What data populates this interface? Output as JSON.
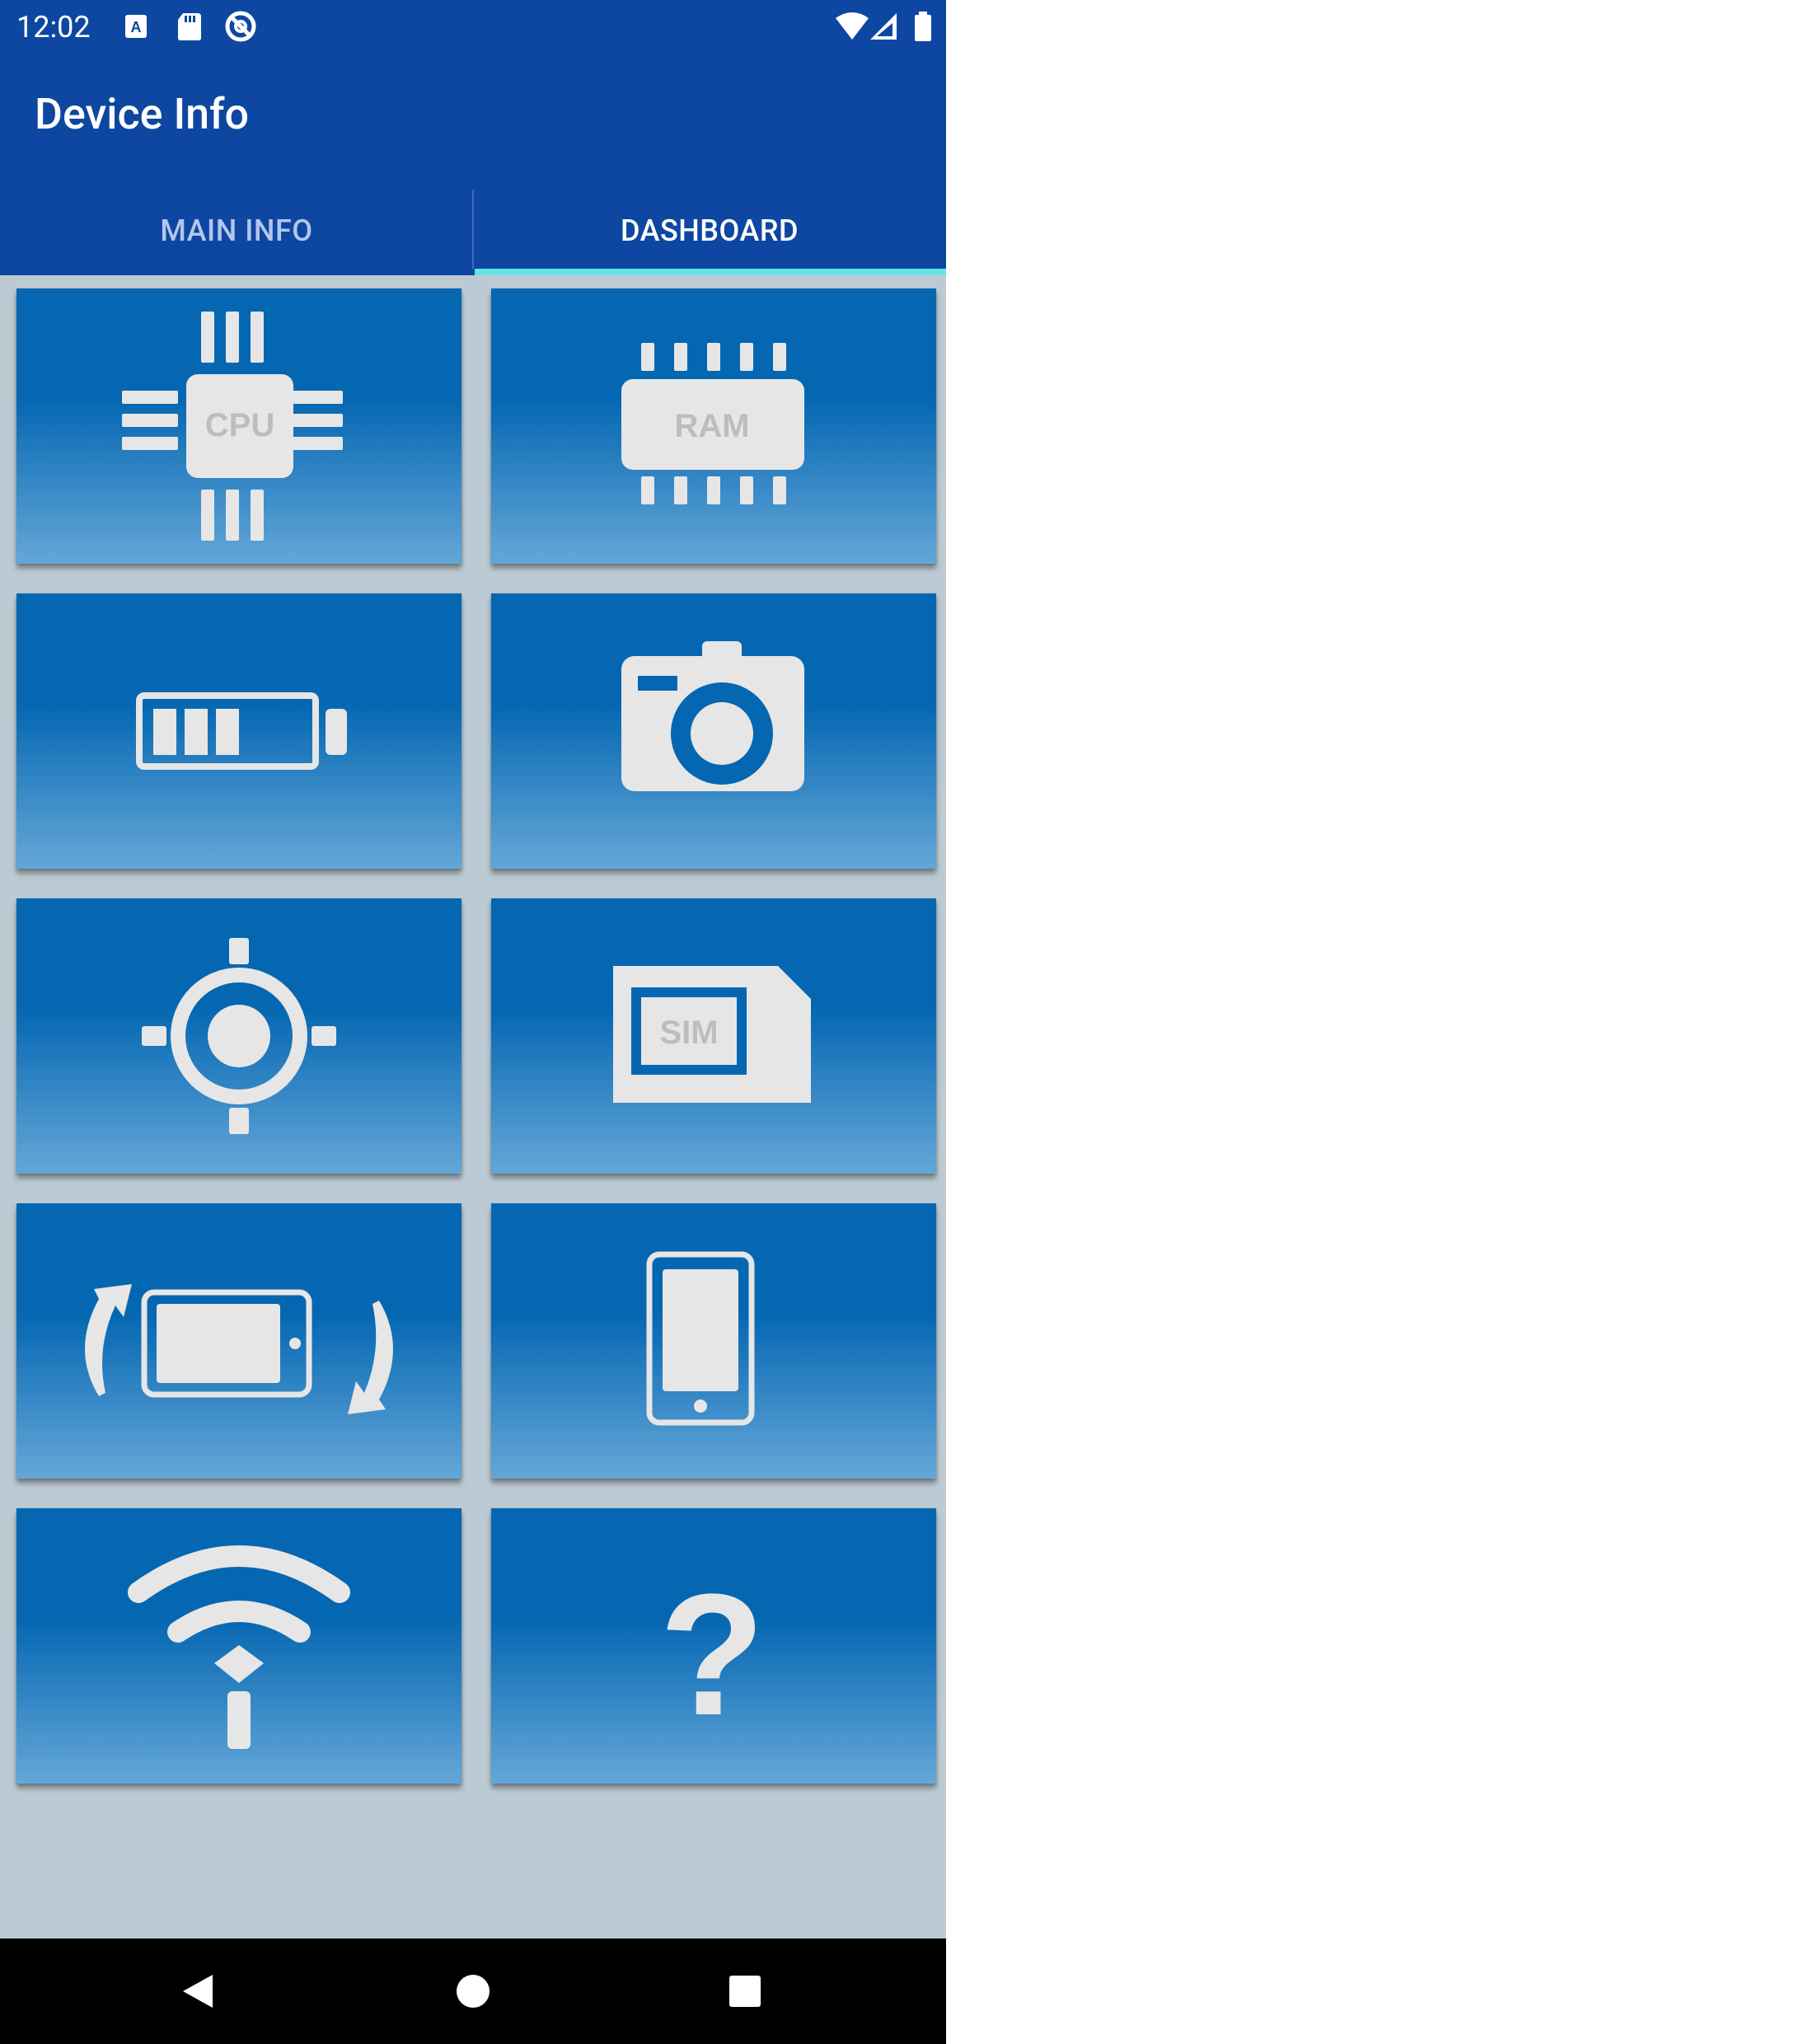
{
  "status_bar": {
    "time": "12:02"
  },
  "app_bar": {
    "title": "Device Info"
  },
  "tabs": [
    {
      "label": "MAIN INFO",
      "selected": false
    },
    {
      "label": "DASHBOARD",
      "selected": true
    }
  ],
  "dashboard": {
    "tiles": [
      {
        "id": "cpu",
        "icon": "cpu-icon",
        "icon_text": "CPU"
      },
      {
        "id": "ram",
        "icon": "ram-icon",
        "icon_text": "RAM"
      },
      {
        "id": "battery",
        "icon": "battery-icon"
      },
      {
        "id": "camera",
        "icon": "camera-icon"
      },
      {
        "id": "gps",
        "icon": "location-target-icon"
      },
      {
        "id": "sim",
        "icon": "sim-card-icon",
        "icon_text": "SIM"
      },
      {
        "id": "sensors",
        "icon": "rotate-device-icon"
      },
      {
        "id": "display",
        "icon": "phone-display-icon"
      },
      {
        "id": "wifi",
        "icon": "wifi-icon"
      },
      {
        "id": "about",
        "icon": "question-icon",
        "icon_text": "?"
      }
    ]
  },
  "colors": {
    "app_bar": "#0e47a1",
    "tab_indicator": "#65e4e6",
    "tile_top": "#0567b2",
    "tile_bottom": "#64a7d8",
    "background": "#bccbd3",
    "icon_fill": "#e8e8e8"
  },
  "navigation_bar": {
    "buttons": [
      "back-icon",
      "home-icon",
      "recents-icon"
    ]
  }
}
